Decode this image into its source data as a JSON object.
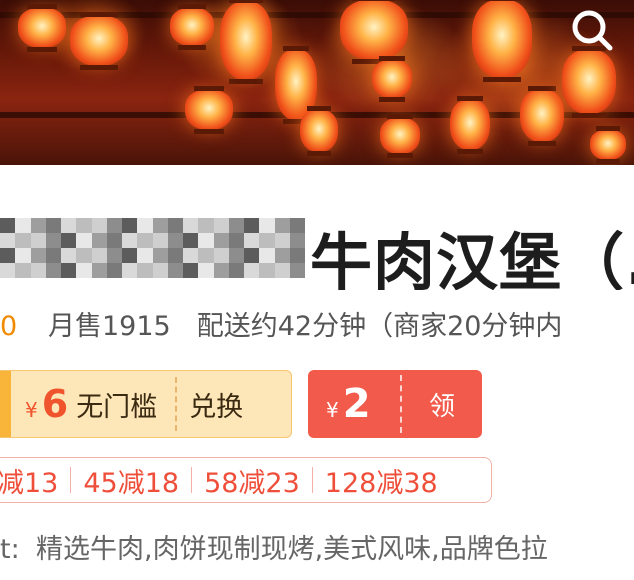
{
  "banner": {
    "search_icon": "search-icon"
  },
  "store": {
    "title_visible": "牛肉汉堡（.",
    "score": "0",
    "monthly_sales": "月售1915",
    "delivery": "配送约42分钟（商家20分钟内"
  },
  "coupons": [
    {
      "currency": "¥",
      "amount": "6",
      "condition": "无门槛",
      "action": "兑换"
    },
    {
      "currency": "¥",
      "amount": "2",
      "action": "领"
    }
  ],
  "discounts": [
    "减13",
    "45减18",
    "58减23",
    "128减38"
  ],
  "notice": {
    "prefix": "t:",
    "text": "精选牛肉,肉饼现制现烤,美式风味,品牌色拉"
  },
  "colors": {
    "accent_red": "#f25a4c",
    "discount_red": "#ef4f3a",
    "coupon_gold": "#fde7b8",
    "score_orange": "#f08a00"
  }
}
